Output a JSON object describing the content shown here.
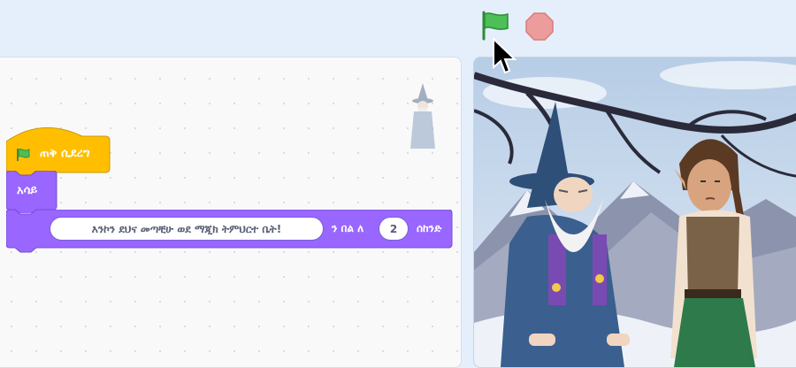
{
  "controls": {
    "green_flag_icon": "green-flag-icon",
    "stop_icon": "stop-icon",
    "flag_color": "#4cbf56",
    "stop_color": "#ec9c9c"
  },
  "code": {
    "hat_block": {
      "label": "ጠቅ ሲደረግ",
      "color": "#ffbf00"
    },
    "say_block": {
      "label": "አሳይ",
      "color": "#9966ff"
    },
    "say_for_block": {
      "message": "እንኮን ደህና መጣቺሁ ወደ ማጂክ ትምህርተ ቤት!",
      "for_label": "ን በል ለ",
      "seconds": "2",
      "seconds_label": "ሰከንድ"
    }
  },
  "stage": {
    "characters": [
      "wizard",
      "young-elf"
    ],
    "backdrop": "snowy-mountains"
  }
}
